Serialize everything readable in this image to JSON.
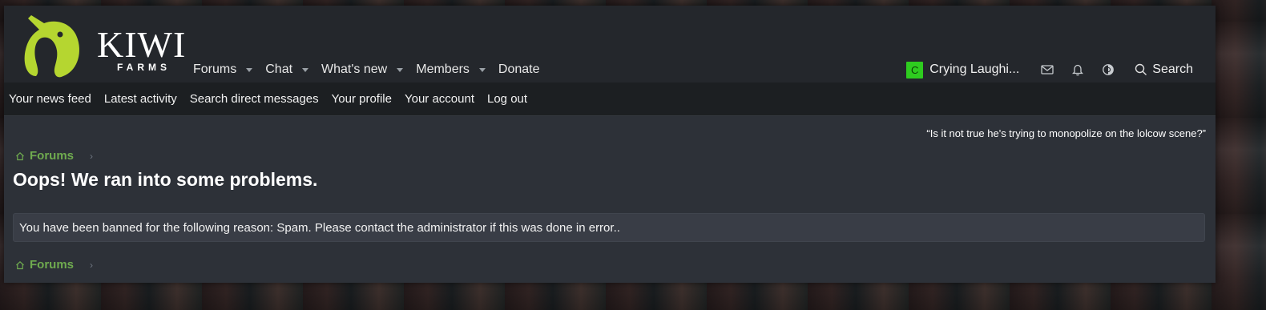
{
  "logo": {
    "title": "KIWI",
    "subtitle": "FARMS"
  },
  "nav": {
    "tabs": [
      {
        "label": "Forums",
        "has_menu": true
      },
      {
        "label": "Chat",
        "has_menu": true
      },
      {
        "label": "What's new",
        "has_menu": true
      },
      {
        "label": "Members",
        "has_menu": true
      },
      {
        "label": "Donate",
        "has_menu": false
      }
    ]
  },
  "user": {
    "avatar_letter": "C",
    "name": "Crying Laughi...",
    "avatar_color": "#2ecc1f",
    "search_label": "Search"
  },
  "subnav": {
    "items": [
      "Your news feed",
      "Latest activity",
      "Search direct messages",
      "Your profile",
      "Your account",
      "Log out"
    ]
  },
  "main": {
    "quote": "“Is it not true he's trying to monopolize on the lolcow scene?”",
    "breadcrumb_label": "Forums",
    "title": "Oops! We ran into some problems.",
    "message": "You have been banned for the following reason: Spam. Please contact the administrator if this was done in error.."
  },
  "colors": {
    "accent_green": "#6fab4f",
    "logo_lime": "#b5d630",
    "header_bg": "#24272c",
    "page_bg": "#2d3138"
  }
}
